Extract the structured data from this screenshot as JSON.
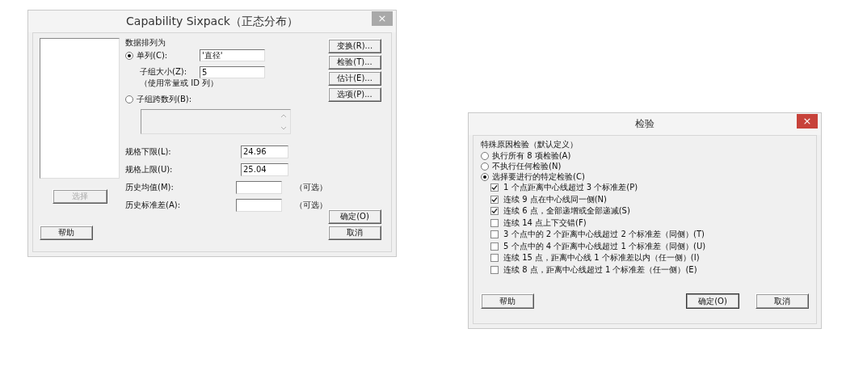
{
  "capability_dialog": {
    "title": "Capability Sixpack（正态分布）",
    "active": false,
    "close": "×",
    "data_label": "数据排列为",
    "single_column": {
      "label": "单列(C):",
      "selected": true,
      "value": "'直径'"
    },
    "subgroup_size": {
      "label": "子组大小(Z):",
      "value": "5",
      "hint": "（使用常量或 ID 列）"
    },
    "subgroups_across": {
      "label": "子组跨数列(B):",
      "selected": false
    },
    "spec_fields": [
      {
        "label": "规格下限(L):",
        "value": "24.96"
      },
      {
        "label": "规格上限(U):",
        "value": "25.04"
      },
      {
        "label": "历史均值(M):",
        "note": "（可选）"
      },
      {
        "label": "历史标准差(A):",
        "note": "（可选）"
      }
    ],
    "side_buttons": [
      "变换(R)...",
      "检验(T)...",
      "估计(E)...",
      "选项(P)..."
    ],
    "select_button": {
      "label": "选择",
      "disabled": true
    },
    "help": "帮助",
    "ok": "确定(O)",
    "cancel": "取消"
  },
  "tests_dialog": {
    "title": "检验",
    "active": true,
    "close": "×",
    "group_label": "特殊原因检验（默认定义）",
    "modes": [
      {
        "label": "执行所有 8 项检验(A)",
        "selected": false
      },
      {
        "label": "不执行任何检验(N)",
        "selected": false
      },
      {
        "label": "选择要进行的特定检验(C)",
        "selected": true
      }
    ],
    "tests": [
      {
        "label": "1 个点距离中心线超过 3 个标准差(P)",
        "checked": true
      },
      {
        "label": "连续 9 点在中心线同一侧(N)",
        "checked": true
      },
      {
        "label": "连续 6 点，全部递增或全部递减(S)",
        "checked": true
      },
      {
        "label": "连续 14 点上下交错(F)",
        "checked": false
      },
      {
        "label": "3 个点中的 2 个距离中心线超过 2 个标准差（同侧）(T)",
        "checked": false
      },
      {
        "label": "5 个点中的 4 个距离中心线超过 1 个标准差（同侧）(U)",
        "checked": false
      },
      {
        "label": "连续 15 点，距离中心线 1 个标准差以内（任一侧）(I)",
        "checked": false
      },
      {
        "label": "连续 8 点，距离中心线超过 1 个标准差（任一侧）(E)",
        "checked": false
      }
    ],
    "help": "帮助",
    "ok": "确定(O)",
    "cancel": "取消"
  }
}
